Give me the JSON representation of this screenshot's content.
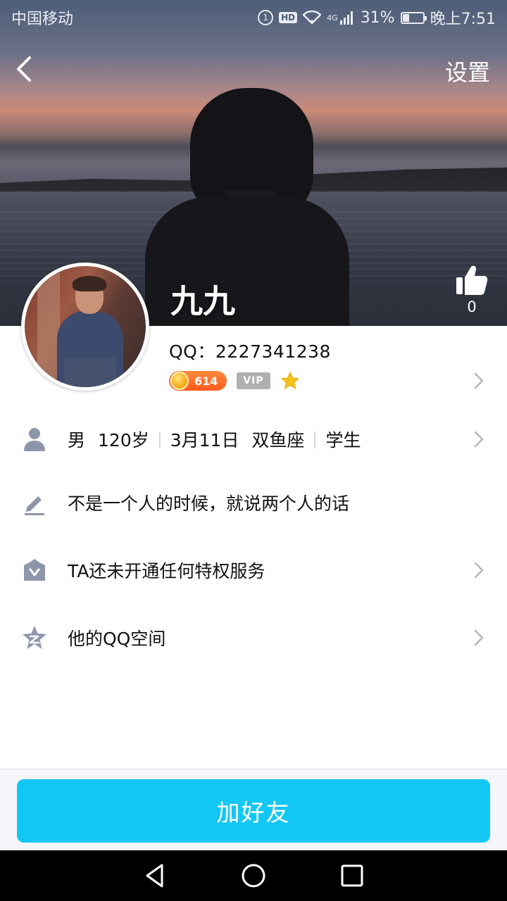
{
  "status_bar": {
    "carrier": "中国移动",
    "network": "4G",
    "battery": "31%",
    "battery_level": 0.31,
    "time": "晚上7:51",
    "hd_label": "HD"
  },
  "nav": {
    "settings_label": "设置",
    "back_icon": "chevron-left-icon"
  },
  "profile": {
    "nickname": "九九",
    "likes": "0",
    "qq_label": "QQ：",
    "qq_number": "2227341238",
    "coin_level": "614",
    "vip_label": "VIP"
  },
  "details": {
    "gender": "男",
    "age": "120岁",
    "birthday": "3月11日",
    "zodiac": "双鱼座",
    "occupation": "学生",
    "signature": "不是一个人的时候，就说两个人的话",
    "privileges": "TA还未开通任何特权服务",
    "qzone": "他的QQ空间"
  },
  "actions": {
    "add_friend": "加好友"
  },
  "colors": {
    "accent": "#12c7f4",
    "icon_gray": "#8e96ac",
    "coin_orange": "#ff6a26"
  }
}
